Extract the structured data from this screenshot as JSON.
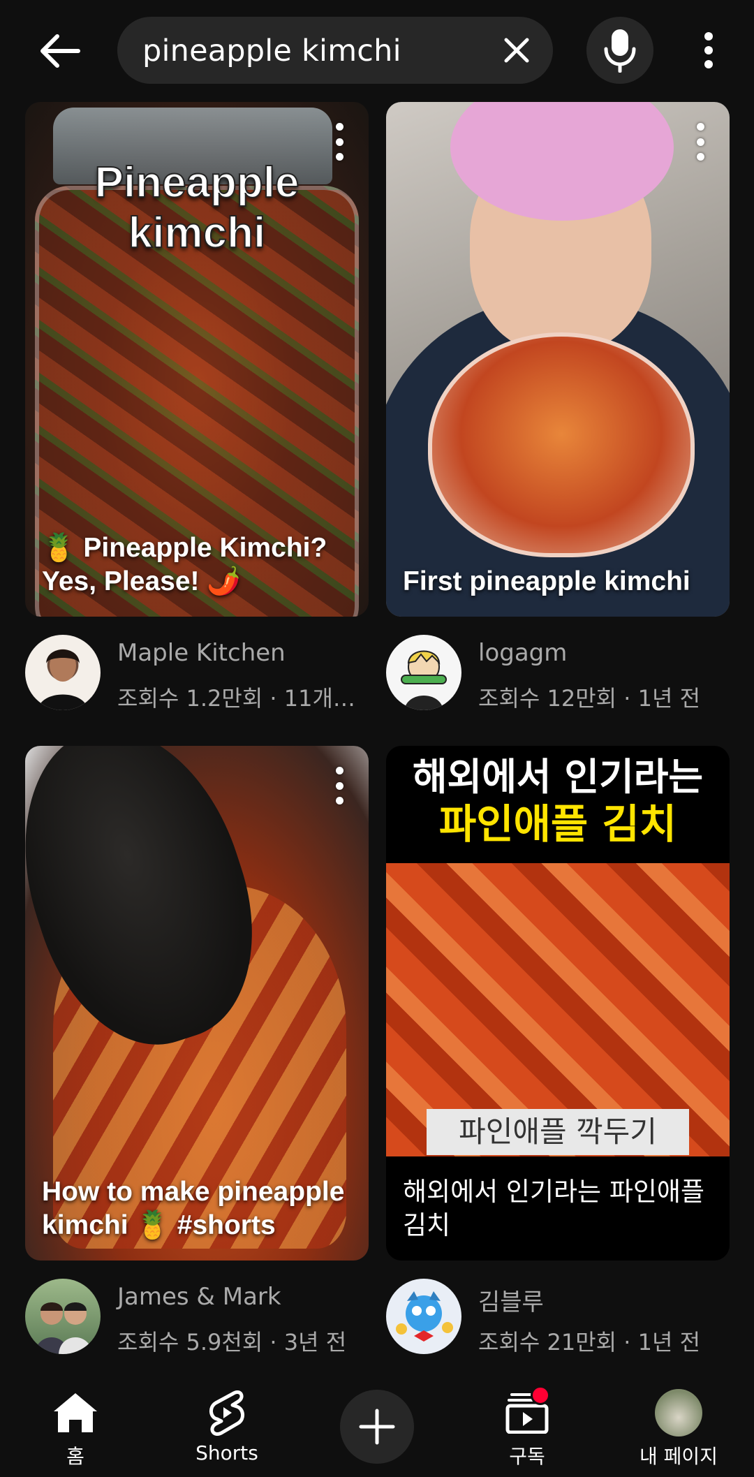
{
  "search": {
    "query": "pineapple kimchi"
  },
  "results": [
    {
      "thumb_label": "Pineapple kimchi",
      "overlay_title": "🍍 Pineapple Kimchi? Yes, Please! 🌶️",
      "channel": "Maple Kitchen",
      "stats": "조회수 1.2만회 · 11개…"
    },
    {
      "overlay_title": "First pineapple kimchi",
      "channel": "logagm",
      "stats": "조회수 12만회 · 1년 전"
    },
    {
      "overlay_title": "How to make pineapple kimchi 🍍 #shorts",
      "channel": "James & Mark",
      "stats": "조회수 5.9천회 · 3년 전"
    },
    {
      "thumb_heading_1": "해외에서 인기라는",
      "thumb_heading_2": "파인애플 김치",
      "thumb_caption": "파인애플 깍두기",
      "overlay_title": "해외에서 인기라는 파인애플 김치",
      "channel": "김블루",
      "stats": "조회수 21만회 · 1년 전"
    }
  ],
  "nav": {
    "home": "홈",
    "shorts": "Shorts",
    "subscriptions": "구독",
    "you": "내 페이지"
  },
  "colors": {
    "background": "#0f0f0f",
    "surface": "#272727",
    "secondary_text": "#aaaaaa",
    "notification": "#ff0033",
    "highlight_yellow": "#ffe400"
  }
}
